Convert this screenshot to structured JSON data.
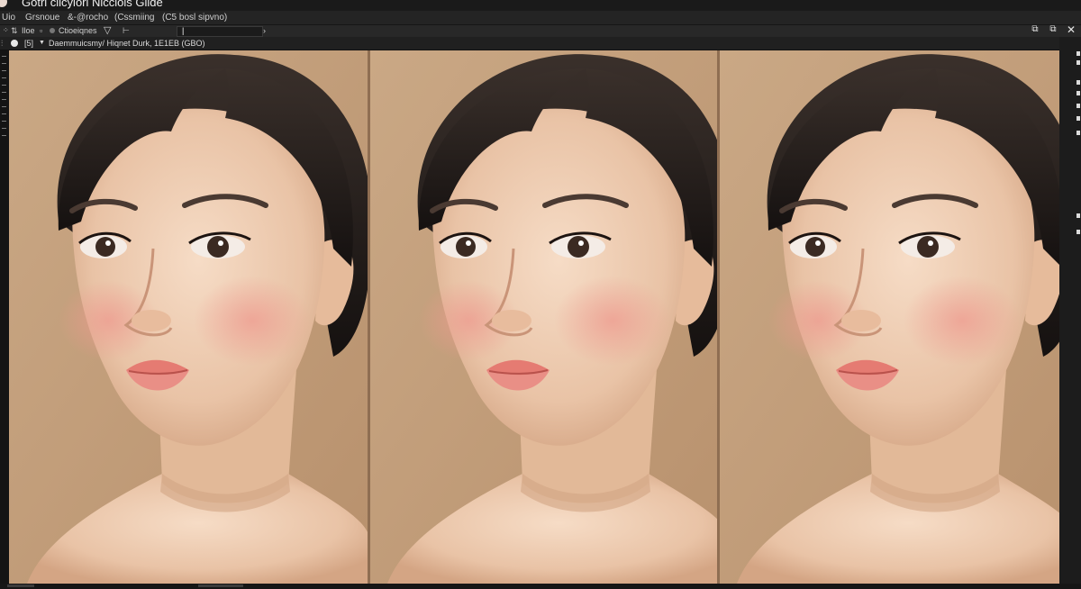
{
  "window": {
    "title": "Gotrl ciicylorl Nicciols Gilde"
  },
  "menu": [
    "Uio",
    "Grsnoue",
    "&-@rocho",
    "(Cssmiing",
    "(C5 bosl sipvno)"
  ],
  "toolbar": {
    "item1": "Iloe",
    "item2": "Ctioeiqnes",
    "field_value": "",
    "arrow": "›"
  },
  "window_controls": {
    "restore": "⧉",
    "fullscreen": "⧉",
    "close": "✕"
  },
  "document": {
    "tab_index": "[5]",
    "tab_label": "Daemmuicsmy/ Hiqnet Durk, 1E1EB (GBO)"
  },
  "icons": {
    "filter": "filter-icon",
    "brush": "brush-icon"
  },
  "colors": {
    "background": "#c19d7a",
    "hair": "#1e1714",
    "skin": "#ecc8ab",
    "blush": "#ee9a8f",
    "lips": "#e57b72"
  },
  "panels": [
    {
      "name": "portrait-variant-1",
      "tone": "light"
    },
    {
      "name": "portrait-variant-2",
      "tone": "warm"
    },
    {
      "name": "portrait-variant-3",
      "tone": "rosy"
    }
  ]
}
